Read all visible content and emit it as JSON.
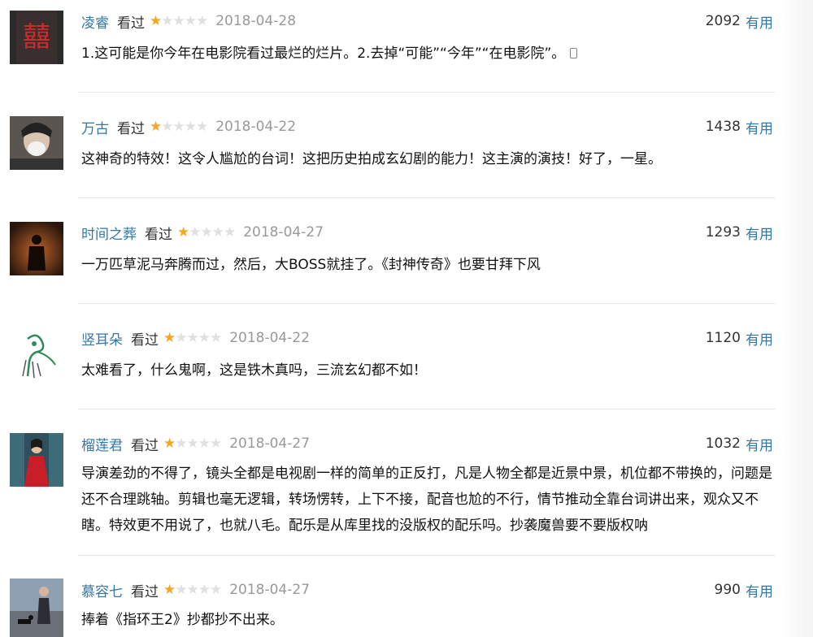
{
  "comments": [
    {
      "author": "凌睿",
      "watched": "看过",
      "rating": 1,
      "date": "2018-04-28",
      "votes": "2092",
      "useful_label": "有用",
      "text": "1.这可能是你今年在电影院看过最烂的烂片。2.去掉“可能”“今年”“在电影院”。",
      "avatar": "red-double-happiness"
    },
    {
      "author": "万古",
      "watched": "看过",
      "rating": 1,
      "date": "2018-04-22",
      "votes": "1438",
      "useful_label": "有用",
      "text": "这神奇的特效！这令人尴尬的台词！这把历史拍成玄幻剧的能力！这主演的演技！好了，一星。",
      "avatar": "person-with-mask"
    },
    {
      "author": "时间之葬",
      "watched": "看过",
      "rating": 1,
      "date": "2018-04-27",
      "votes": "1293",
      "useful_label": "有用",
      "text": "一万匹草泥马奔腾而过，然后，大BOSS就挂了。《封神传奇》也要甘拜下风",
      "avatar": "dark-figure"
    },
    {
      "author": "竖耳朵",
      "watched": "看过",
      "rating": 1,
      "date": "2018-04-22",
      "votes": "1120",
      "useful_label": "有用",
      "text": "太难看了，什么鬼啊，这是铁木真吗，三流玄幻都不如！",
      "avatar": "green-sketch"
    },
    {
      "author": "榴莲君",
      "watched": "看过",
      "rating": 1,
      "date": "2018-04-27",
      "votes": "1032",
      "useful_label": "有用",
      "text": "导演差劲的不得了，镜头全都是电视剧一样的简单的正反打，凡是人物全都是近景中景，机位都不带换的，问题是还不合理跳轴。剪辑也毫无逻辑，转场愣转，上下不接，配音也尬的不行，情节推动全靠台词讲出来，观众又不瞎。特效更不用说了，也就八毛。配乐是从库里找的没版权的配乐吗。抄袭魔兽要不要版权呐",
      "avatar": "woman-in-red"
    },
    {
      "author": "慕容七",
      "watched": "看过",
      "rating": 1,
      "date": "2018-04-27",
      "votes": "990",
      "useful_label": "有用",
      "text": "捧着《指环王2》抄都抄不出来。",
      "avatar": "man-with-dog"
    }
  ]
}
